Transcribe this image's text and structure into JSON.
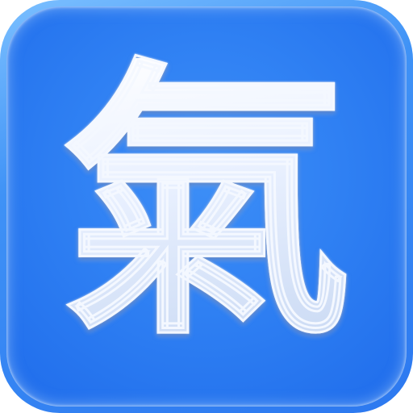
{
  "app_icon": {
    "character": "氣",
    "colors": {
      "background_top": "#7cc0ff",
      "background_mid": "#3f92f6",
      "background_bottom": "#1f6ceb",
      "glyph_fill": "#dfe9ff",
      "glyph_outline": "#f4f8ff"
    }
  }
}
